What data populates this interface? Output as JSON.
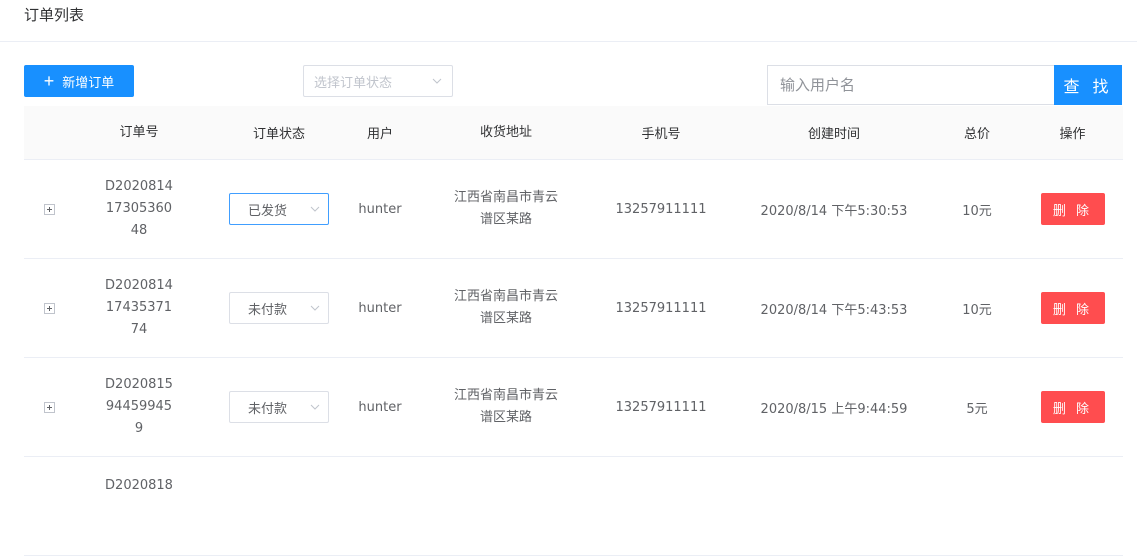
{
  "page": {
    "title": "订单列表"
  },
  "toolbar": {
    "add_label": "新增订单",
    "status_placeholder": "选择订单状态",
    "search_placeholder": "输入用户名",
    "search_label": "查 找"
  },
  "table": {
    "headers": [
      "订单号",
      "订单状态",
      "用户",
      "收货地址",
      "手机号",
      "创建时间",
      "总价",
      "操作"
    ],
    "rows": [
      {
        "id_lines": [
          "D2020814",
          "17305360",
          "48"
        ],
        "status": "已发货",
        "user": "hunter",
        "addr_lines": [
          "江西省南昌市青云",
          "谱区某路"
        ],
        "phone": "13257911111",
        "created": "2020/8/14 下午5:30:53",
        "total": "10元",
        "action": "删 除"
      },
      {
        "id_lines": [
          "D2020814",
          "17435371",
          "74"
        ],
        "status": "未付款",
        "user": "hunter",
        "addr_lines": [
          "江西省南昌市青云",
          "谱区某路"
        ],
        "phone": "13257911111",
        "created": "2020/8/14 下午5:43:53",
        "total": "10元",
        "action": "删 除"
      },
      {
        "id_lines": [
          "D2020815",
          "94459945",
          "9"
        ],
        "status": "未付款",
        "user": "hunter",
        "addr_lines": [
          "江西省南昌市青云",
          "谱区某路"
        ],
        "phone": "13257911111",
        "created": "2020/8/15 上午9:44:59",
        "total": "5元",
        "action": "删 除"
      },
      {
        "id_lines": [
          "D2020818",
          "",
          ""
        ],
        "status": "",
        "user": "",
        "addr_lines": [
          "",
          ""
        ],
        "phone": "",
        "created": "",
        "total": "",
        "action": ""
      }
    ]
  },
  "colors": {
    "primary": "#1890ff",
    "danger": "#ff4d4f",
    "border": "#dcdfe6"
  }
}
